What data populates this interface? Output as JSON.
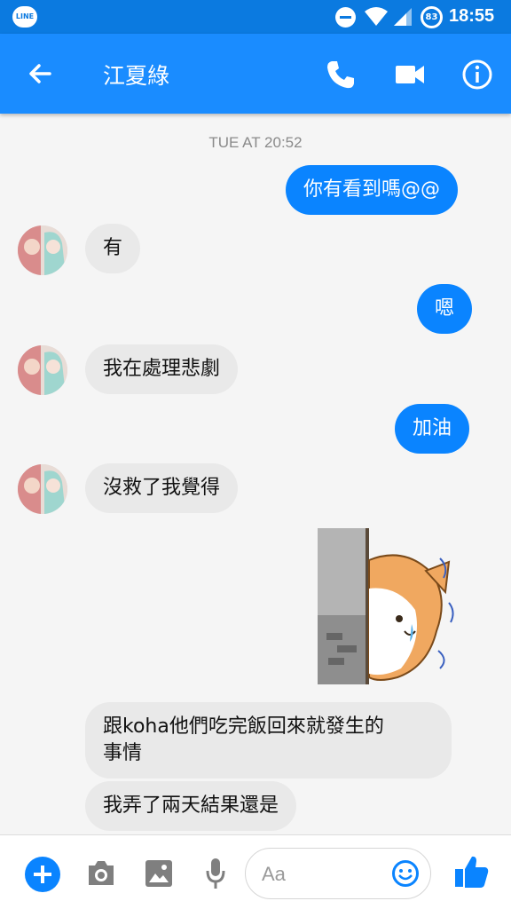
{
  "status_bar": {
    "app_badge": "LINE",
    "battery_level": "83",
    "time": "18:55"
  },
  "header": {
    "contact_name": "江夏綠"
  },
  "conversation": {
    "timestamp": "TUE AT 20:52",
    "messages": [
      {
        "direction": "outgoing",
        "text": "你有看到嗎@@"
      },
      {
        "direction": "incoming",
        "text": "有"
      },
      {
        "direction": "outgoing",
        "text": "嗯"
      },
      {
        "direction": "incoming",
        "text": "我在處理悲劇"
      },
      {
        "direction": "outgoing",
        "text": "加油"
      },
      {
        "direction": "incoming",
        "text": "沒救了我覺得"
      },
      {
        "direction": "outgoing",
        "type": "sticker",
        "sticker": "scared-cat-behind-wall"
      },
      {
        "direction": "incoming",
        "text_line1": "跟koha他們吃完飯回來就發生的",
        "text_line2": "事情"
      },
      {
        "direction": "incoming",
        "text": "我弄了兩天結果還是"
      }
    ]
  },
  "composer": {
    "placeholder": "Aa"
  },
  "colors": {
    "header": "#1a8cff",
    "status_bar": "#0b7ae0",
    "outgoing_bubble": "#0a84ff",
    "incoming_bubble": "#e9e9e9"
  }
}
